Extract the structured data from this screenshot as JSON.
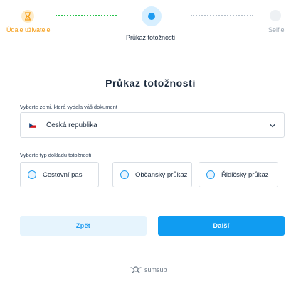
{
  "stepper": {
    "steps": [
      {
        "label": "Údaje uživatele",
        "state": "completed",
        "icon": "hourglass-icon"
      },
      {
        "label": "Průkaz totožnosti",
        "state": "active",
        "icon": "dot-icon"
      },
      {
        "label": "Selfie",
        "state": "pending",
        "icon": "circle-icon"
      }
    ],
    "colors": {
      "completed": "#f59b12",
      "active": "#1e9bf0",
      "done_line": "#27c24c",
      "pending_line": "#b3bec9"
    }
  },
  "main": {
    "title": "Průkaz totožnosti",
    "country": {
      "label": "Vyberte zemi, která vydala váš dokument",
      "value": "Česká republika",
      "flag_icon": "czech-flag-icon"
    },
    "doc_type": {
      "label": "Vyberte typ dokladu totožnosti",
      "options": [
        "Cestovní pas",
        "Občanský průkaz",
        "Řidičský průkaz"
      ]
    }
  },
  "actions": {
    "back_label": "Zpět",
    "next_label": "Další",
    "accent": "#109cf1"
  },
  "footer": {
    "brand": "sumsub"
  }
}
